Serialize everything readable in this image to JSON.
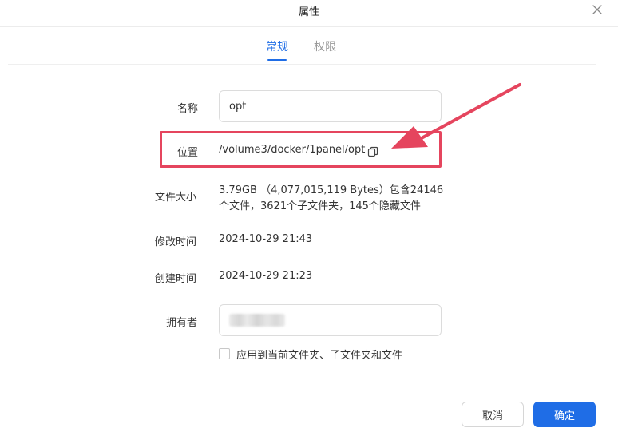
{
  "dialog": {
    "title": "属性"
  },
  "tabs": [
    {
      "label": "常规",
      "active": true
    },
    {
      "label": "权限",
      "active": false
    }
  ],
  "fields": {
    "name": {
      "label": "名称",
      "value": "opt"
    },
    "location": {
      "label": "位置",
      "value": "/volume3/docker/1panel/opt"
    },
    "size": {
      "label": "文件大小",
      "line1": "3.79GB （4,077,015,119 Bytes）包含24146",
      "line2": "个文件，3621个子文件夹，145个隐藏文件"
    },
    "modified": {
      "label": "修改时间",
      "value": "2024-10-29 21:43"
    },
    "created": {
      "label": "创建时间",
      "value": "2024-10-29 21:23"
    },
    "owner": {
      "label": "拥有者"
    }
  },
  "apply_checkbox": {
    "label": "应用到当前文件夹、子文件夹和文件",
    "checked": false
  },
  "footer": {
    "cancel_label": "取消",
    "ok_label": "确定"
  },
  "colors": {
    "accent": "#1f6de6",
    "annotation": "#e5455e"
  }
}
